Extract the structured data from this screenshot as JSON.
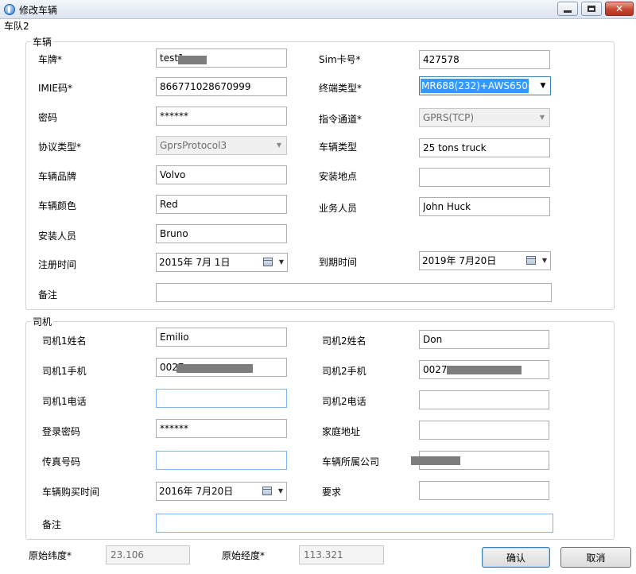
{
  "window": {
    "title": "修改车辆"
  },
  "fleet": "车队2",
  "vehicle": {
    "legend": "车辆",
    "plate_label": "车牌*",
    "plate": "test1",
    "sim_label": "Sim卡号*",
    "sim": "427578",
    "imei_label": "IMIE码*",
    "imei": "866771028670999",
    "terminal_label": "终端类型*",
    "terminal": "MR688(232)+AWS650",
    "password_label": "密码",
    "password": "******",
    "channel_label": "指令通道*",
    "channel": "GPRS(TCP)",
    "protocol_label": "协议类型*",
    "protocol": "GprsProtocol3",
    "type_label": "车辆类型",
    "type": "25 tons truck",
    "brand_label": "车辆品牌",
    "brand": "Volvo",
    "location_label": "安装地点",
    "location": "",
    "color_label": "车辆颜色",
    "color": "Red",
    "sales_label": "业务人员",
    "sales": "John Huck",
    "installer_label": "安装人员",
    "installer": "Bruno",
    "register_label": "注册时间",
    "register": "2015年  7月  1日",
    "expire_label": "到期时间",
    "expire": "2019年  7月20日",
    "remark_label": "备注",
    "remark": ""
  },
  "driver": {
    "legend": "司机",
    "d1_name_label": "司机1姓名",
    "d1_name": "Emilio",
    "d2_name_label": "司机2姓名",
    "d2_name": "Don",
    "d1_mobile_label": "司机1手机",
    "d1_mobile": "0027",
    "d2_mobile_label": "司机2手机",
    "d2_mobile": "0027",
    "d1_phone_label": "司机1电话",
    "d1_phone": "",
    "d2_phone_label": "司机2电话",
    "d2_phone": "",
    "login_pw_label": "登录密码",
    "login_pw": "******",
    "home_label": "家庭地址",
    "home": "",
    "fax_label": "传真号码",
    "fax": "",
    "company_label": "车辆所属公司",
    "company": "T",
    "purchase_label": "车辆购买时间",
    "purchase": "2016年  7月20日",
    "require_label": "要求",
    "require": "",
    "remark_label": "备注",
    "remark": ""
  },
  "footer": {
    "lat_label": "原始纬度*",
    "lat": "23.106",
    "lon_label": "原始经度*",
    "lon": "113.321",
    "ok": "确认",
    "cancel": "取消"
  }
}
